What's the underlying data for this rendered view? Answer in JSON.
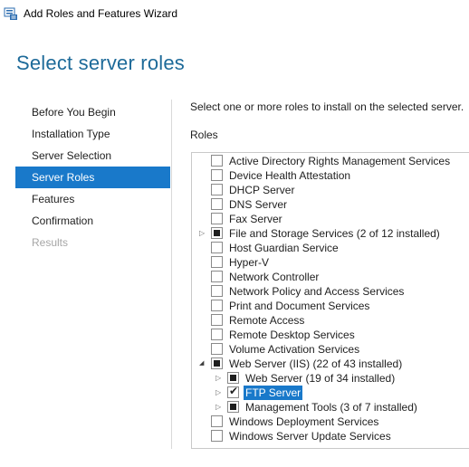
{
  "window": {
    "title": "Add Roles and Features Wizard",
    "icon": "server-manager-icon"
  },
  "page_title": "Select server roles",
  "nav": [
    {
      "label": "Before You Begin",
      "state": "normal"
    },
    {
      "label": "Installation Type",
      "state": "normal"
    },
    {
      "label": "Server Selection",
      "state": "normal"
    },
    {
      "label": "Server Roles",
      "state": "selected"
    },
    {
      "label": "Features",
      "state": "normal"
    },
    {
      "label": "Confirmation",
      "state": "normal"
    },
    {
      "label": "Results",
      "state": "disabled"
    }
  ],
  "description": "Select one or more roles to install on the selected server.",
  "roles_label": "Roles",
  "roles": [
    {
      "label": "Active Directory Rights Management Services",
      "level": 0,
      "check": "none",
      "expander": false
    },
    {
      "label": "Device Health Attestation",
      "level": 0,
      "check": "none",
      "expander": false
    },
    {
      "label": "DHCP Server",
      "level": 0,
      "check": "none",
      "expander": false
    },
    {
      "label": "DNS Server",
      "level": 0,
      "check": "none",
      "expander": false
    },
    {
      "label": "Fax Server",
      "level": 0,
      "check": "none",
      "expander": false
    },
    {
      "label": "File and Storage Services (2 of 12 installed)",
      "level": 0,
      "check": "partial",
      "expander": "collapsed"
    },
    {
      "label": "Host Guardian Service",
      "level": 0,
      "check": "none",
      "expander": false
    },
    {
      "label": "Hyper-V",
      "level": 0,
      "check": "none",
      "expander": false
    },
    {
      "label": "Network Controller",
      "level": 0,
      "check": "none",
      "expander": false
    },
    {
      "label": "Network Policy and Access Services",
      "level": 0,
      "check": "none",
      "expander": false
    },
    {
      "label": "Print and Document Services",
      "level": 0,
      "check": "none",
      "expander": false
    },
    {
      "label": "Remote Access",
      "level": 0,
      "check": "none",
      "expander": false
    },
    {
      "label": "Remote Desktop Services",
      "level": 0,
      "check": "none",
      "expander": false
    },
    {
      "label": "Volume Activation Services",
      "level": 0,
      "check": "none",
      "expander": false
    },
    {
      "label": "Web Server (IIS) (22 of 43 installed)",
      "level": 0,
      "check": "partial",
      "expander": "expanded"
    },
    {
      "label": "Web Server (19 of 34 installed)",
      "level": 1,
      "check": "partial",
      "expander": "collapsed"
    },
    {
      "label": "FTP Server",
      "level": 1,
      "check": "checked",
      "expander": "collapsed",
      "selected": true
    },
    {
      "label": "Management Tools (3 of 7 installed)",
      "level": 1,
      "check": "partial",
      "expander": "collapsed"
    },
    {
      "label": "Windows Deployment Services",
      "level": 0,
      "check": "none",
      "expander": false
    },
    {
      "label": "Windows Server Update Services",
      "level": 0,
      "check": "none",
      "expander": false
    }
  ]
}
